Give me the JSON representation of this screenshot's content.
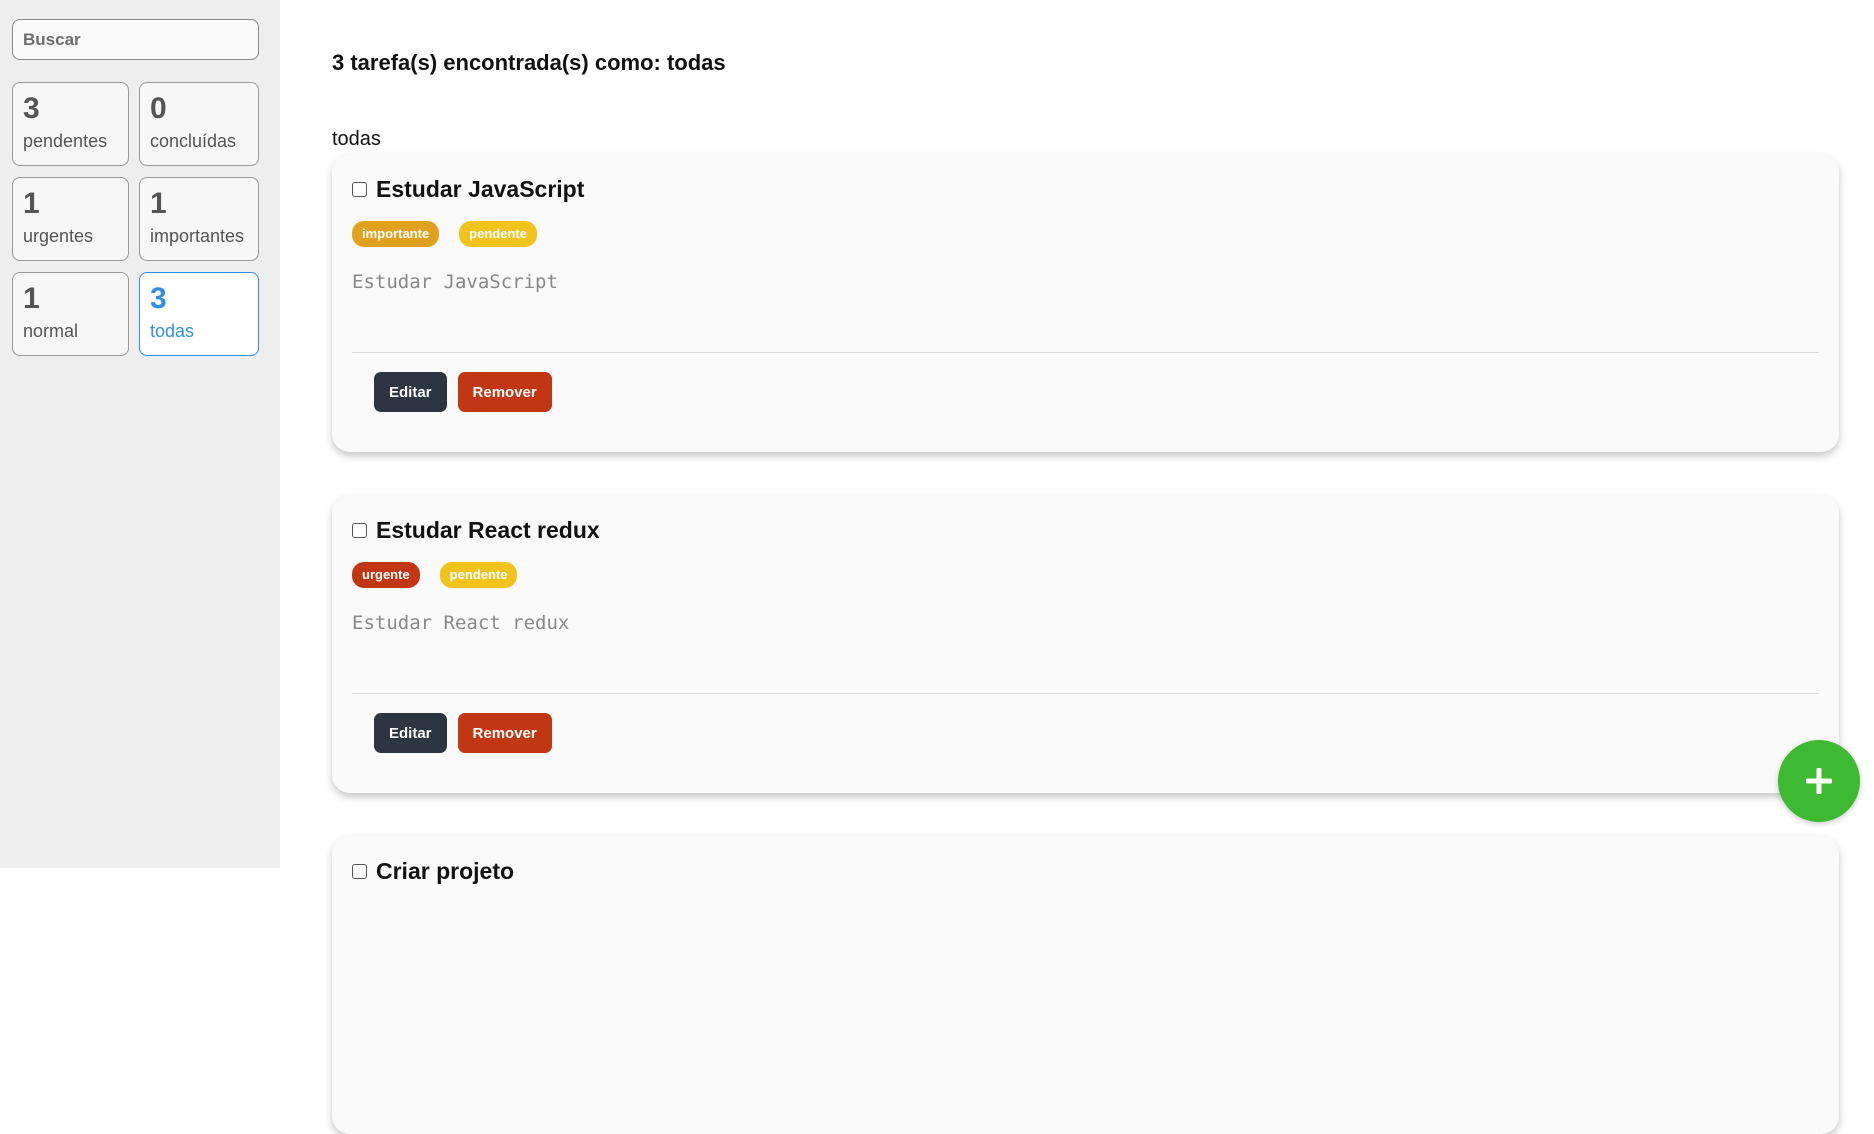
{
  "search": {
    "placeholder": "Buscar",
    "value": ""
  },
  "filters": [
    {
      "count": "3",
      "label": "pendentes",
      "active": false
    },
    {
      "count": "0",
      "label": "concluídas",
      "active": false
    },
    {
      "count": "1",
      "label": "urgentes",
      "active": false
    },
    {
      "count": "1",
      "label": "importantes",
      "active": false
    },
    {
      "count": "1",
      "label": "normal",
      "active": false
    },
    {
      "count": "3",
      "label": "todas",
      "active": true
    }
  ],
  "main": {
    "summary": "3 tarefa(s) encontrada(s) como: todas",
    "current_filter": "todas"
  },
  "tasks": [
    {
      "title": "Estudar JavaScript",
      "tags": [
        {
          "label": "importante",
          "color": "#e0a21e"
        },
        {
          "label": "pendente",
          "color": "#f2c31b"
        }
      ],
      "description": "Estudar JavaScript",
      "edit_label": "Editar",
      "remove_label": "Remover"
    },
    {
      "title": "Estudar React redux",
      "tags": [
        {
          "label": "urgente",
          "color": "#c13714"
        },
        {
          "label": "pendente",
          "color": "#f2c31b"
        }
      ],
      "description": "Estudar React redux",
      "edit_label": "Editar",
      "remove_label": "Remover"
    },
    {
      "title": "Criar projeto",
      "tags": [],
      "description": "",
      "edit_label": "",
      "remove_label": ""
    }
  ],
  "fab": {
    "icon": "plus-icon",
    "color": "#3dba31"
  },
  "colors": {
    "accent": "#2f8fe6",
    "edit": "#2d3540",
    "remove": "#c13714"
  }
}
